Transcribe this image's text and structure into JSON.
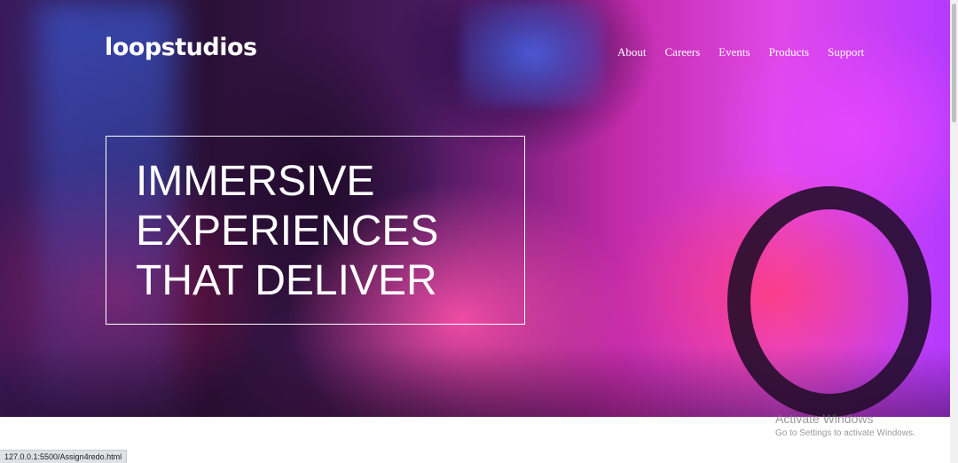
{
  "header": {
    "logo_text": "loopstudios",
    "nav": [
      {
        "label": "About"
      },
      {
        "label": "Careers"
      },
      {
        "label": "Events"
      },
      {
        "label": "Products"
      },
      {
        "label": "Support"
      }
    ]
  },
  "hero": {
    "headline_lines": [
      "IMMERSIVE",
      "EXPERIENCES",
      "THAT DELIVER"
    ]
  },
  "os_watermark": {
    "title": "Activate Windows",
    "subtitle": "Go to Settings to activate Windows."
  },
  "status_bar": {
    "url": "127.0.0.1:5500/Assign4redo.html"
  }
}
